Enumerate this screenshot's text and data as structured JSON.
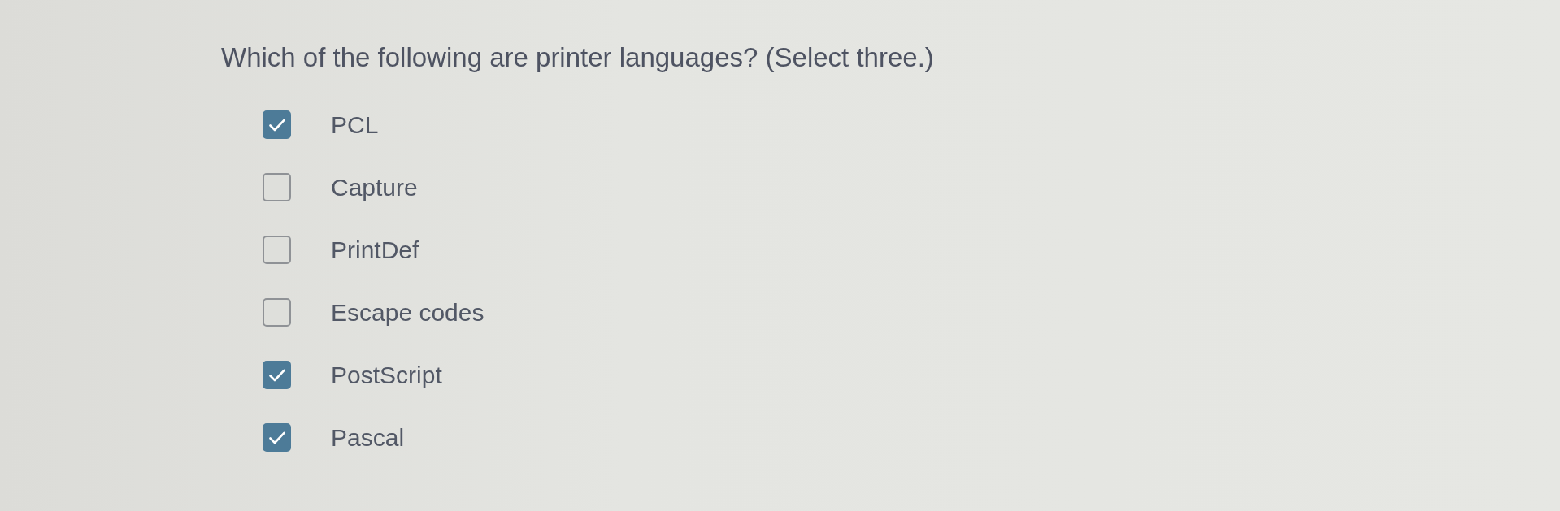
{
  "question": "Which of the following are printer languages? (Select three.)",
  "options": [
    {
      "label": "PCL",
      "checked": true
    },
    {
      "label": "Capture",
      "checked": false
    },
    {
      "label": "PrintDef",
      "checked": false
    },
    {
      "label": "Escape codes",
      "checked": false
    },
    {
      "label": "PostScript",
      "checked": true
    },
    {
      "label": "Pascal",
      "checked": true
    }
  ]
}
